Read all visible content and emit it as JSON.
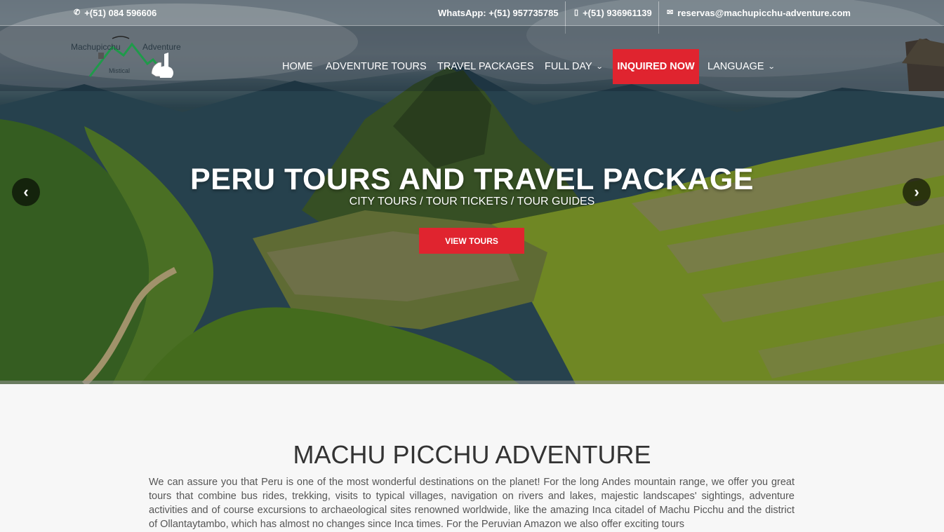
{
  "topbar": {
    "phone": "+(51) 084 596606",
    "whatsapp": "WhatsApp: +(51) 957735785",
    "mobile": "+(51) 936961139",
    "email": "reservas@machupicchu-adventure.com",
    "icons": [
      "phone-icon",
      "mobile-icon",
      "envelope-icon"
    ]
  },
  "logo": {
    "line1": "Machupicchu",
    "line2": "Adventure",
    "line3": "Mistical"
  },
  "nav": {
    "home": "HOME",
    "adventure": "ADVENTURE TOURS",
    "packages": "TRAVEL PACKAGES",
    "fullday": "FULL DAY",
    "inquire": "INQUIRED NOW",
    "language": "LANGUAGE"
  },
  "slide": {
    "title": "PERU TOURS AND TRAVEL PACKAGE",
    "subtitle": "CITY TOURS / TOUR TICKETS / TOUR GUIDES",
    "button": "VIEW TOURS",
    "prev": "‹",
    "next": "›"
  },
  "about": {
    "heading": "MACHU PICCHU ADVENTURE",
    "text": "We can assure you that Peru is one of the most wonderful destinations on the planet! For the long Andes mountain range, we offer you great tours that combine bus rides, trekking, visits to typical villages, navigation on rivers and lakes, majestic landscapes' sightings, adventure activities and of course excursions to archaeological sites renowned worldwide, like the amazing Inca citadel of Machu Picchu and the district of Ollantaytambo, which has almost no changes since Inca times. For the Peruvian Amazon we also offer exciting tours"
  },
  "colors": {
    "accent": "#e0242f",
    "heading": "#333333",
    "body_text": "#555555"
  }
}
